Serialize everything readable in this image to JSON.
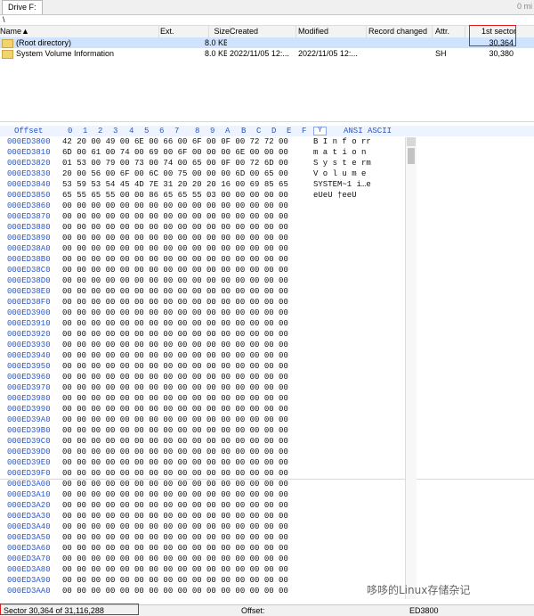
{
  "tabbar": {
    "active_tab": "Drive F:",
    "right_fragment": "0 mi"
  },
  "path": "\\",
  "file_list": {
    "columns": [
      "Name▲",
      "Ext.",
      "Size",
      "Created",
      "Modified",
      "Record changed",
      "Attr.",
      "1st sector"
    ],
    "rows": [
      {
        "name": "(Root directory)",
        "ext": "",
        "size": "8.0 KB",
        "created": "",
        "modified": "",
        "record_changed": "",
        "attr": "",
        "first_sector": "30,364"
      },
      {
        "name": "System Volume Information",
        "ext": "",
        "size": "8.0 KB",
        "created": "2022/11/05  12:...",
        "modified": "2022/11/05  12:...",
        "record_changed": "",
        "attr": "SH",
        "first_sector": "30,380"
      }
    ]
  },
  "hex_header": {
    "offset": "Offset",
    "cols": [
      "0",
      "1",
      "2",
      "3",
      "4",
      "5",
      "6",
      "7",
      "8",
      "9",
      "A",
      "B",
      "C",
      "D",
      "E",
      "F"
    ],
    "marker": "Y",
    "ascii_label": "ANSI ASCII"
  },
  "hex_rows": [
    {
      "offset": "000ED3800",
      "bytes": "42 20 00 49 00 6E 00 66  00 6F 00 0F 00 72 72 00",
      "ascii": "B  I n f o     rr"
    },
    {
      "offset": "000ED3810",
      "bytes": "6D 00 61 00 74 00 69 00  6F 00 00 00 6E 00 00 00",
      "ascii": "m a t i o     n"
    },
    {
      "offset": "000ED3820",
      "bytes": "01 53 00 79 00 73 00 74  00 65 00 0F 00 72 6D 00",
      "ascii": "  S y s t e     rm"
    },
    {
      "offset": "000ED3830",
      "bytes": "20 00 56 00 6F 00 6C 00  75 00 00 00 6D 00 65 00",
      "ascii": "  V o l u m e"
    },
    {
      "offset": "000ED3840",
      "bytes": "53 59 53 54 45 4D 7E 31  20 20 20 16 00 69 85 65",
      "ascii": "SYSTEM~1    i…e"
    },
    {
      "offset": "000ED3850",
      "bytes": "65 55 65 55 00 00 86 65  65 55 03 00 00 00 00 00",
      "ascii": "eUeU  †eeU"
    },
    {
      "offset": "000ED3860",
      "bytes": "00 00 00 00 00 00 00 00  00 00 00 00 00 00 00 00",
      "ascii": ""
    },
    {
      "offset": "000ED3870",
      "bytes": "00 00 00 00 00 00 00 00  00 00 00 00 00 00 00 00",
      "ascii": ""
    },
    {
      "offset": "000ED3880",
      "bytes": "00 00 00 00 00 00 00 00  00 00 00 00 00 00 00 00",
      "ascii": ""
    },
    {
      "offset": "000ED3890",
      "bytes": "00 00 00 00 00 00 00 00  00 00 00 00 00 00 00 00",
      "ascii": ""
    },
    {
      "offset": "000ED38A0",
      "bytes": "00 00 00 00 00 00 00 00  00 00 00 00 00 00 00 00",
      "ascii": ""
    },
    {
      "offset": "000ED38B0",
      "bytes": "00 00 00 00 00 00 00 00  00 00 00 00 00 00 00 00",
      "ascii": ""
    },
    {
      "offset": "000ED38C0",
      "bytes": "00 00 00 00 00 00 00 00  00 00 00 00 00 00 00 00",
      "ascii": ""
    },
    {
      "offset": "000ED38D0",
      "bytes": "00 00 00 00 00 00 00 00  00 00 00 00 00 00 00 00",
      "ascii": ""
    },
    {
      "offset": "000ED38E0",
      "bytes": "00 00 00 00 00 00 00 00  00 00 00 00 00 00 00 00",
      "ascii": ""
    },
    {
      "offset": "000ED38F0",
      "bytes": "00 00 00 00 00 00 00 00  00 00 00 00 00 00 00 00",
      "ascii": ""
    },
    {
      "offset": "000ED3900",
      "bytes": "00 00 00 00 00 00 00 00  00 00 00 00 00 00 00 00",
      "ascii": ""
    },
    {
      "offset": "000ED3910",
      "bytes": "00 00 00 00 00 00 00 00  00 00 00 00 00 00 00 00",
      "ascii": ""
    },
    {
      "offset": "000ED3920",
      "bytes": "00 00 00 00 00 00 00 00  00 00 00 00 00 00 00 00",
      "ascii": ""
    },
    {
      "offset": "000ED3930",
      "bytes": "00 00 00 00 00 00 00 00  00 00 00 00 00 00 00 00",
      "ascii": ""
    },
    {
      "offset": "000ED3940",
      "bytes": "00 00 00 00 00 00 00 00  00 00 00 00 00 00 00 00",
      "ascii": ""
    },
    {
      "offset": "000ED3950",
      "bytes": "00 00 00 00 00 00 00 00  00 00 00 00 00 00 00 00",
      "ascii": ""
    },
    {
      "offset": "000ED3960",
      "bytes": "00 00 00 00 00 00 00 00  00 00 00 00 00 00 00 00",
      "ascii": ""
    },
    {
      "offset": "000ED3970",
      "bytes": "00 00 00 00 00 00 00 00  00 00 00 00 00 00 00 00",
      "ascii": ""
    },
    {
      "offset": "000ED3980",
      "bytes": "00 00 00 00 00 00 00 00  00 00 00 00 00 00 00 00",
      "ascii": ""
    },
    {
      "offset": "000ED3990",
      "bytes": "00 00 00 00 00 00 00 00  00 00 00 00 00 00 00 00",
      "ascii": ""
    },
    {
      "offset": "000ED39A0",
      "bytes": "00 00 00 00 00 00 00 00  00 00 00 00 00 00 00 00",
      "ascii": ""
    },
    {
      "offset": "000ED39B0",
      "bytes": "00 00 00 00 00 00 00 00  00 00 00 00 00 00 00 00",
      "ascii": ""
    },
    {
      "offset": "000ED39C0",
      "bytes": "00 00 00 00 00 00 00 00  00 00 00 00 00 00 00 00",
      "ascii": ""
    },
    {
      "offset": "000ED39D0",
      "bytes": "00 00 00 00 00 00 00 00  00 00 00 00 00 00 00 00",
      "ascii": ""
    },
    {
      "offset": "000ED39E0",
      "bytes": "00 00 00 00 00 00 00 00  00 00 00 00 00 00 00 00",
      "ascii": ""
    },
    {
      "offset": "000ED39F0",
      "bytes": "00 00 00 00 00 00 00 00  00 00 00 00 00 00 00 00",
      "ascii": ""
    },
    {
      "offset": "000ED3A00",
      "bytes": "00 00 00 00 00 00 00 00  00 00 00 00 00 00 00 00",
      "ascii": ""
    },
    {
      "offset": "000ED3A10",
      "bytes": "00 00 00 00 00 00 00 00  00 00 00 00 00 00 00 00",
      "ascii": ""
    },
    {
      "offset": "000ED3A20",
      "bytes": "00 00 00 00 00 00 00 00  00 00 00 00 00 00 00 00",
      "ascii": ""
    },
    {
      "offset": "000ED3A30",
      "bytes": "00 00 00 00 00 00 00 00  00 00 00 00 00 00 00 00",
      "ascii": ""
    },
    {
      "offset": "000ED3A40",
      "bytes": "00 00 00 00 00 00 00 00  00 00 00 00 00 00 00 00",
      "ascii": ""
    },
    {
      "offset": "000ED3A50",
      "bytes": "00 00 00 00 00 00 00 00  00 00 00 00 00 00 00 00",
      "ascii": ""
    },
    {
      "offset": "000ED3A60",
      "bytes": "00 00 00 00 00 00 00 00  00 00 00 00 00 00 00 00",
      "ascii": ""
    },
    {
      "offset": "000ED3A70",
      "bytes": "00 00 00 00 00 00 00 00  00 00 00 00 00 00 00 00",
      "ascii": ""
    },
    {
      "offset": "000ED3A80",
      "bytes": "00 00 00 00 00 00 00 00  00 00 00 00 00 00 00 00",
      "ascii": ""
    },
    {
      "offset": "000ED3A90",
      "bytes": "00 00 00 00 00 00 00 00  00 00 00 00 00 00 00 00",
      "ascii": ""
    },
    {
      "offset": "000ED3AA0",
      "bytes": "00 00 00 00 00 00 00 00  00 00 00 00 00 00 00 00",
      "ascii": ""
    }
  ],
  "status": {
    "sector": "Sector 30,364 of 31,116,288",
    "offset_label": "Offset:",
    "offset_value": "ED3800"
  },
  "watermark": "哆哆的Linux存储杂记"
}
